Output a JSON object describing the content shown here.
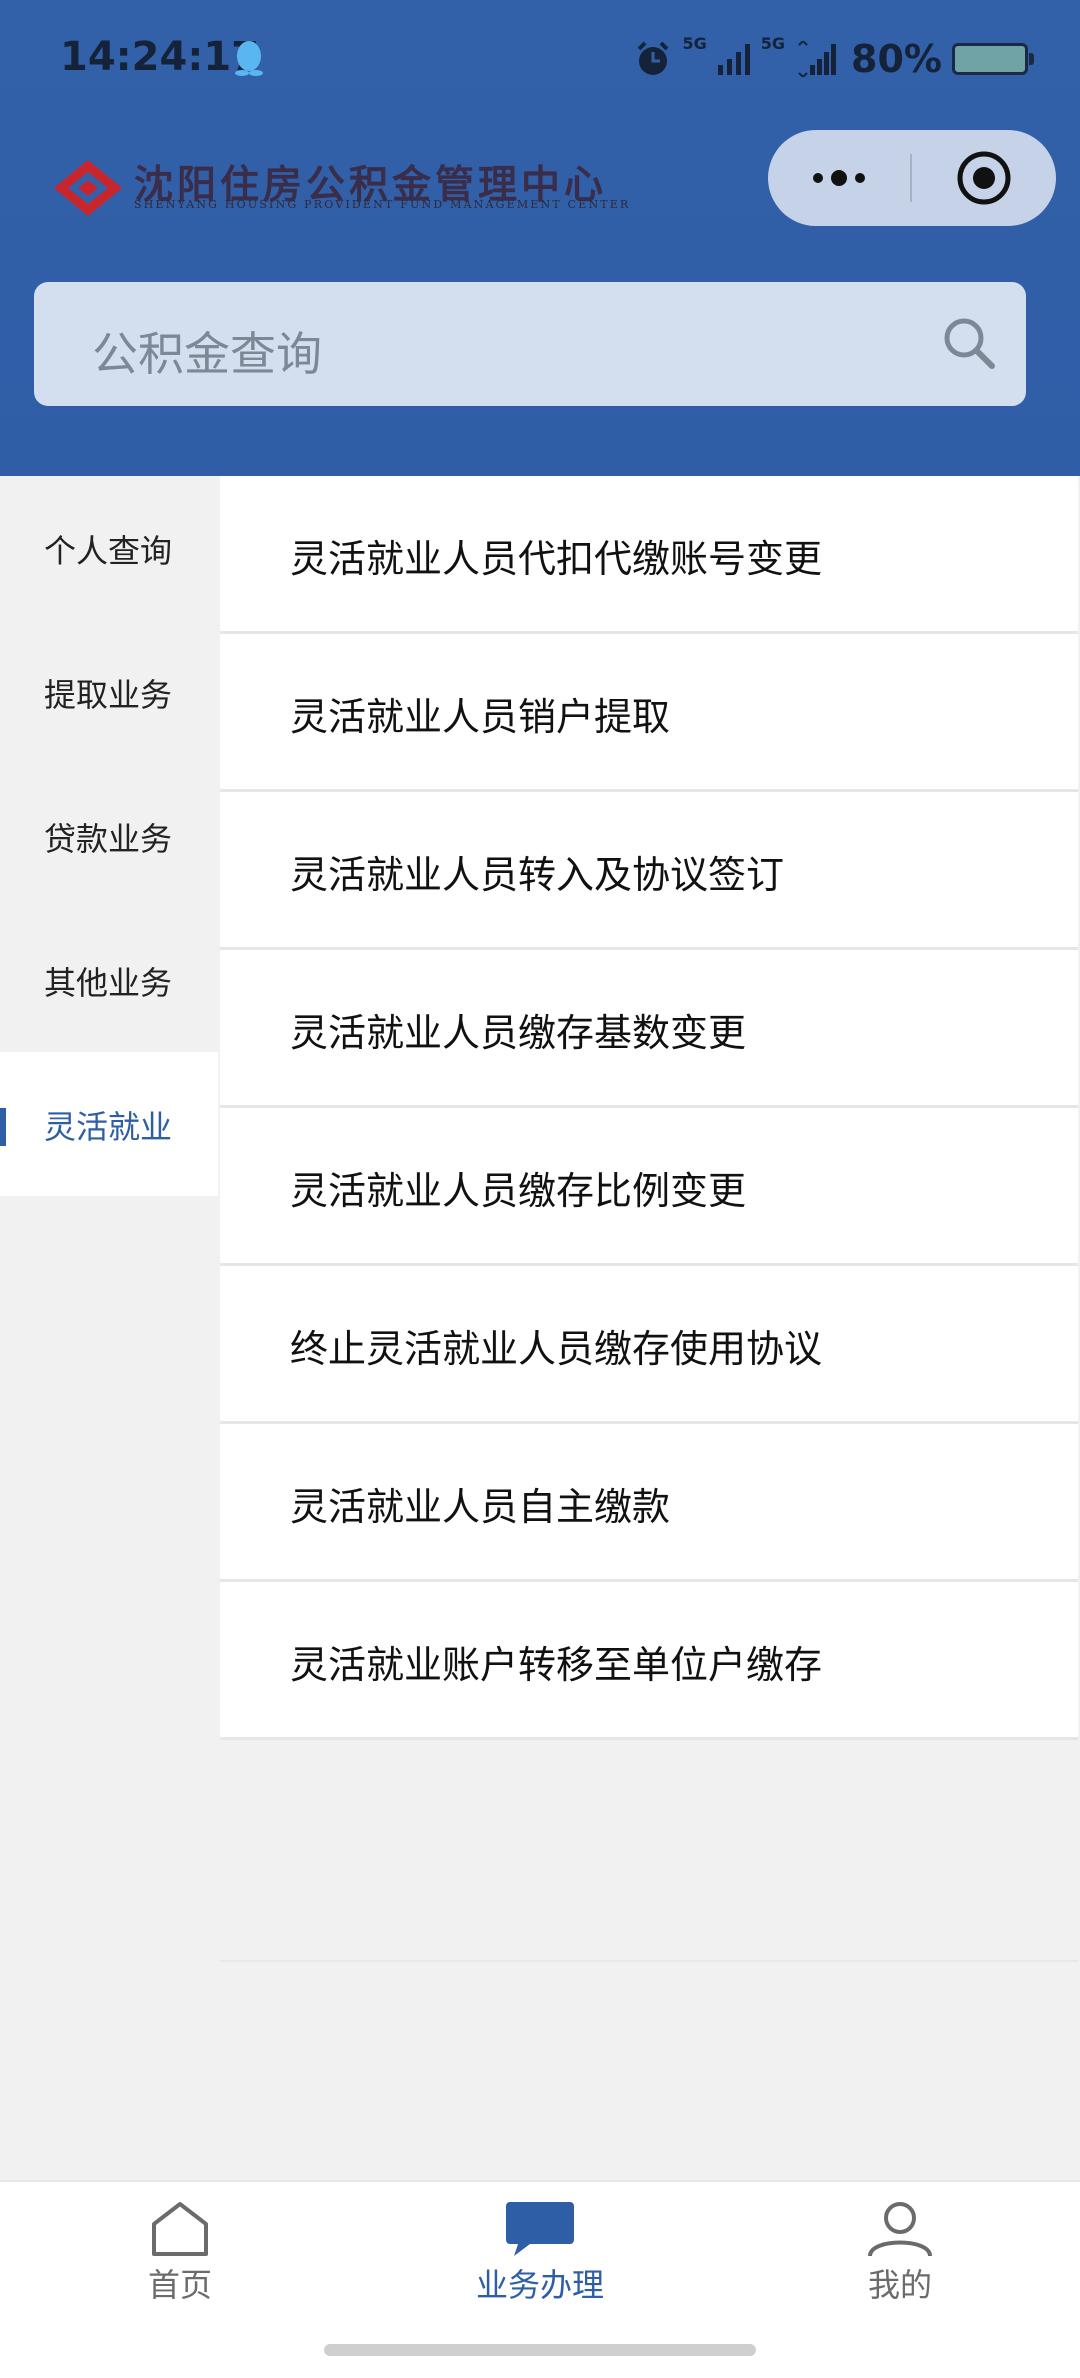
{
  "status_bar": {
    "time": "14:24:17",
    "network_1": "5G",
    "network_2": "5G",
    "battery": "80%"
  },
  "header": {
    "logo_title": "沈阳住房公积金管理中心",
    "logo_subtitle": "SHENYANG HOUSING PROVIDENT FUND MANAGEMENT CENTER",
    "search_placeholder": "公积金查询"
  },
  "sidebar": {
    "items": [
      {
        "label": "个人查询"
      },
      {
        "label": "提取业务"
      },
      {
        "label": "贷款业务"
      },
      {
        "label": "其他业务"
      },
      {
        "label": "灵活就业"
      }
    ],
    "active_index": 4
  },
  "services": [
    {
      "label": "灵活就业人员代扣代缴账号变更"
    },
    {
      "label": "灵活就业人员销户提取"
    },
    {
      "label": "灵活就业人员转入及协议签订"
    },
    {
      "label": "灵活就业人员缴存基数变更"
    },
    {
      "label": "灵活就业人员缴存比例变更"
    },
    {
      "label": "终止灵活就业人员缴存使用协议"
    },
    {
      "label": "灵活就业人员自主缴款"
    },
    {
      "label": "灵活就业账户转移至单位户缴存"
    }
  ],
  "tabbar": {
    "tabs": [
      {
        "label": "首页",
        "icon": "home-icon"
      },
      {
        "label": "业务办理",
        "icon": "chat-bubble-icon"
      },
      {
        "label": "我的",
        "icon": "user-icon"
      }
    ],
    "active_index": 1
  },
  "colors": {
    "primary": "#2e5ea6",
    "header_bg": "#3260a9",
    "search_bg": "#d3dfef",
    "logo_red": "#c8262c"
  }
}
